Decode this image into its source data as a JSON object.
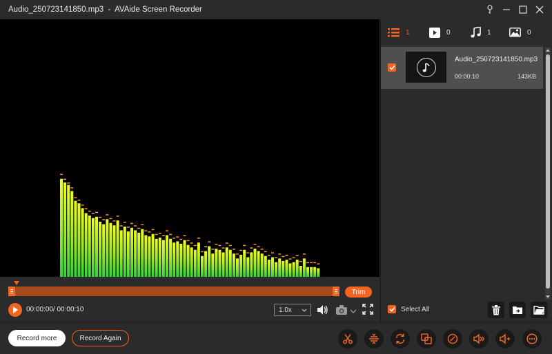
{
  "window": {
    "title": "Audio_250723141850.mp3  -  AVAide Screen Recorder"
  },
  "colors": {
    "accent": "#f26522",
    "bar_green": "#3fd93f",
    "bar_yellow": "#e8f21f",
    "peak": "#ff9b2e",
    "background": "#2b2b2b"
  },
  "spectrum": {
    "levels": [
      0.8,
      0.77,
      0.75,
      0.7,
      0.62,
      0.6,
      0.56,
      0.52,
      0.5,
      0.48,
      0.49,
      0.45,
      0.43,
      0.47,
      0.44,
      0.42,
      0.46,
      0.38,
      0.41,
      0.37,
      0.4,
      0.38,
      0.36,
      0.39,
      0.34,
      0.33,
      0.35,
      0.31,
      0.32,
      0.3,
      0.34,
      0.31,
      0.28,
      0.29,
      0.27,
      0.3,
      0.26,
      0.24,
      0.22,
      0.28,
      0.17,
      0.21,
      0.25,
      0.19,
      0.23,
      0.22,
      0.2,
      0.24,
      0.22,
      0.19,
      0.15,
      0.18,
      0.22,
      0.16,
      0.2,
      0.23,
      0.21,
      0.19,
      0.17,
      0.14,
      0.16,
      0.12,
      0.15,
      0.13,
      0.14,
      0.11,
      0.12,
      0.14,
      0.09,
      0.15,
      0.08,
      0.08,
      0.08,
      0.07
    ],
    "peaks": [
      0.84,
      0.8,
      0.77,
      0.73,
      0.65,
      0.63,
      0.59,
      0.56,
      0.54,
      0.52,
      0.53,
      0.49,
      0.47,
      0.51,
      0.48,
      0.46,
      0.5,
      0.42,
      0.45,
      0.41,
      0.44,
      0.42,
      0.4,
      0.43,
      0.38,
      0.37,
      0.39,
      0.35,
      0.36,
      0.34,
      0.38,
      0.35,
      0.32,
      0.33,
      0.31,
      0.34,
      0.3,
      0.28,
      0.26,
      0.32,
      0.21,
      0.25,
      0.29,
      0.23,
      0.27,
      0.26,
      0.24,
      0.28,
      0.26,
      0.23,
      0.19,
      0.22,
      0.26,
      0.2,
      0.24,
      0.27,
      0.25,
      0.23,
      0.21,
      0.18,
      0.2,
      0.16,
      0.19,
      0.17,
      0.18,
      0.15,
      0.16,
      0.18,
      0.13,
      0.19,
      0.12,
      0.12,
      0.12,
      0.11
    ]
  },
  "trim": {
    "label": "Trim",
    "playhead_fraction": 0.0
  },
  "playback": {
    "time": "00:00:00/ 00:00:10",
    "speed": "1.0x"
  },
  "media_filters": [
    {
      "icon": "list-icon",
      "count": "1"
    },
    {
      "icon": "video-icon",
      "count": "0"
    },
    {
      "icon": "music-icon",
      "count": "1"
    },
    {
      "icon": "image-icon",
      "count": "0"
    }
  ],
  "file_item": {
    "name": "Audio_250723141850.mp3",
    "duration": "00:00:10",
    "size": "143KB",
    "checked": true
  },
  "panel": {
    "select_all": "Select All"
  },
  "bottom": {
    "record_more": "Record more",
    "record_again": "Record Again"
  }
}
